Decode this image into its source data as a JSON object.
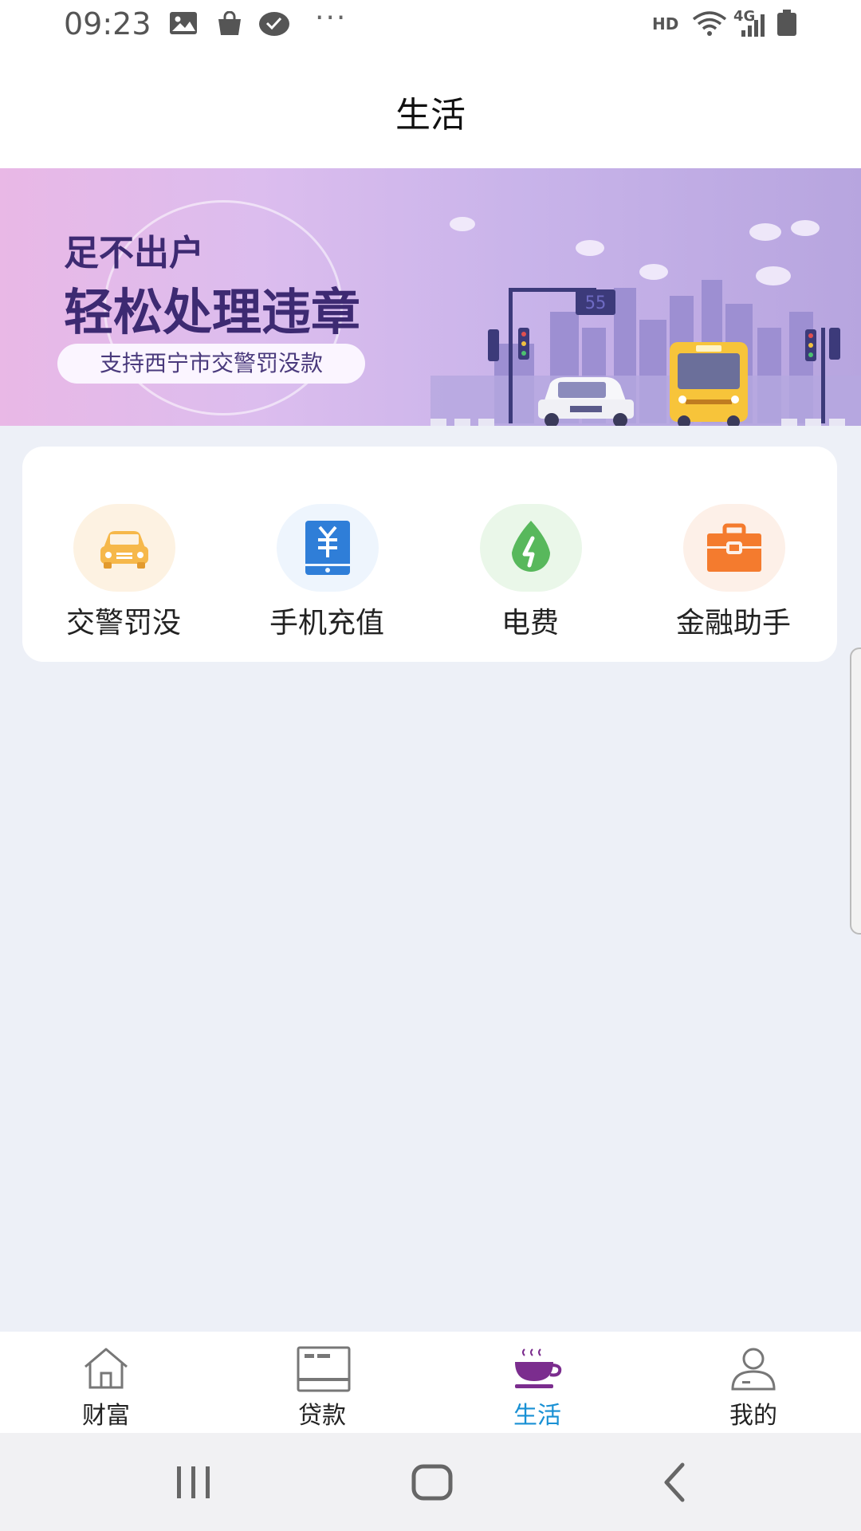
{
  "status_bar": {
    "time": "09:23",
    "more_dots": "···",
    "hd": "HD",
    "network": "4G",
    "icons": [
      "image-icon",
      "shopping-bag-icon",
      "check-bubble-icon",
      "wifi-icon",
      "signal-icon",
      "battery-icon"
    ]
  },
  "header": {
    "title": "生活"
  },
  "banner": {
    "line1": "足不出户",
    "line2": "轻松处理违章",
    "pill": "支持西宁市交警罚没款",
    "sign_number": "55"
  },
  "services": [
    {
      "label": "交警罚没",
      "icon": "car-icon",
      "color": "#f6b84a",
      "bg": "#fdf2e2"
    },
    {
      "label": "手机充值",
      "icon": "phone-recharge-icon",
      "color": "#2f7ed8",
      "bg": "#eef5fd"
    },
    {
      "label": "电费",
      "icon": "electricity-drop-icon",
      "color": "#58b85c",
      "bg": "#eaf7e9"
    },
    {
      "label": "金融助手",
      "icon": "briefcase-icon",
      "color": "#f47b2e",
      "bg": "#fdf0e8"
    }
  ],
  "tabs": [
    {
      "label": "财富",
      "icon": "home-icon",
      "active": false
    },
    {
      "label": "贷款",
      "icon": "card-icon",
      "active": false
    },
    {
      "label": "生活",
      "icon": "coffee-cup-icon",
      "active": true
    },
    {
      "label": "我的",
      "icon": "user-icon",
      "active": false
    }
  ],
  "colors": {
    "active_tab": "#1890d4",
    "active_icon": "#7b2d8e",
    "banner_text": "#3d2a72"
  }
}
